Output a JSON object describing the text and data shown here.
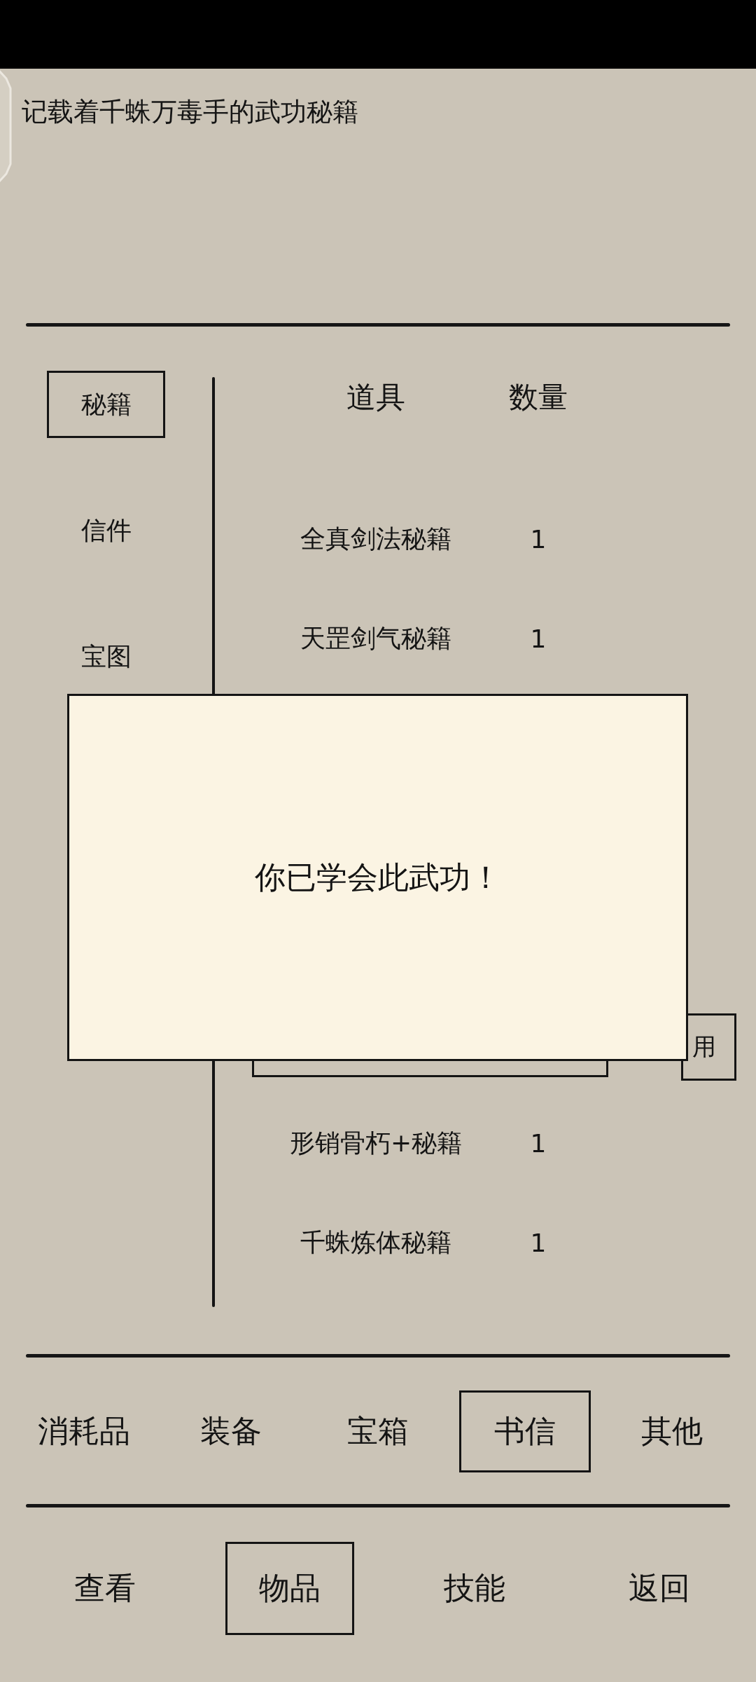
{
  "description": "记载着千蛛万毒手的武功秘籍",
  "categories": [
    {
      "label": "秘籍",
      "selected": true
    },
    {
      "label": "信件",
      "selected": false
    },
    {
      "label": "宝图",
      "selected": false
    }
  ],
  "item_table": {
    "columns": [
      "道具",
      "数量"
    ],
    "rows": [
      {
        "name": "全真剑法秘籍",
        "count": "1",
        "selected": false
      },
      {
        "name": "天罡剑气秘籍",
        "count": "1",
        "selected": false
      },
      {
        "selected": true,
        "action": "用"
      },
      {
        "name": "形销骨朽+秘籍",
        "count": "1",
        "selected": false
      },
      {
        "name": "千蛛炼体秘籍",
        "count": "1",
        "selected": false
      }
    ]
  },
  "dialog": {
    "message": "你已学会此武功！"
  },
  "item_tabs": [
    {
      "label": "消耗品",
      "selected": false
    },
    {
      "label": "装备",
      "selected": false
    },
    {
      "label": "宝箱",
      "selected": false
    },
    {
      "label": "书信",
      "selected": true
    },
    {
      "label": "其他",
      "selected": false
    }
  ],
  "nav_tabs": [
    {
      "label": "查看",
      "selected": false
    },
    {
      "label": "物品",
      "selected": true
    },
    {
      "label": "技能",
      "selected": false
    },
    {
      "label": "返回",
      "selected": false
    }
  ]
}
